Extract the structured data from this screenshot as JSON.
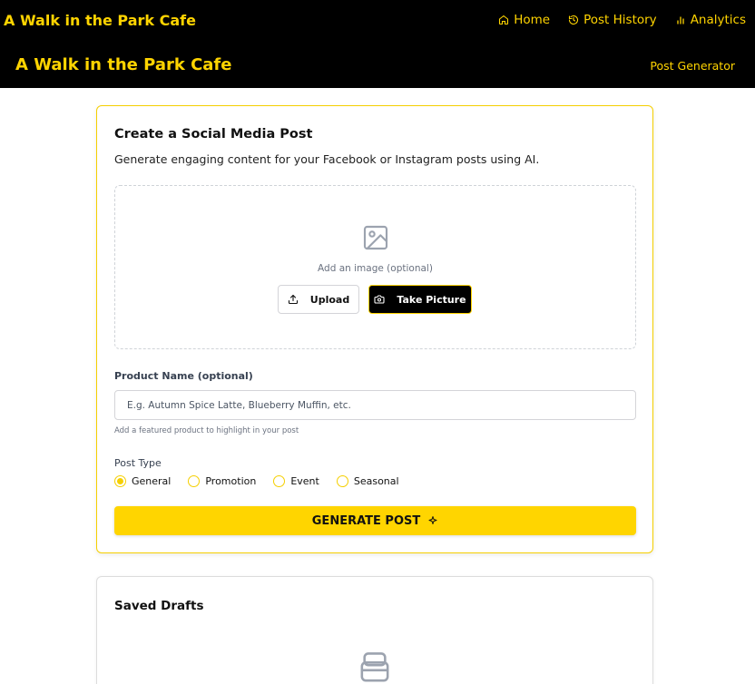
{
  "header": {
    "brand_top": "A Walk in the Park Cafe",
    "brand_main": "A Walk in the Park Cafe",
    "nav": [
      {
        "label": "Home",
        "icon": "home-icon"
      },
      {
        "label": "Post History",
        "icon": "history-icon"
      },
      {
        "label": "Analytics",
        "icon": "bar-chart-icon"
      }
    ],
    "page_link": "Post Generator"
  },
  "create": {
    "title": "Create a Social Media Post",
    "subtitle": "Generate engaging content for your Facebook or Instagram posts using AI.",
    "image_prompt": "Add an image (optional)",
    "upload_label": "Upload",
    "camera_label": "Take Picture",
    "product_label": "Product Name (optional)",
    "product_placeholder": "E.g. Autumn Spice Latte, Blueberry Muffin, etc.",
    "product_value": "",
    "product_help": "Add a featured product to highlight in your post",
    "post_type_label": "Post Type",
    "post_types": [
      "General",
      "Promotion",
      "Event",
      "Seasonal"
    ],
    "selected_post_type": "General",
    "generate_label": "GENERATE POST"
  },
  "drafts": {
    "title": "Saved Drafts"
  },
  "colors": {
    "accent": "#FFD500",
    "header_bg": "#000000"
  }
}
